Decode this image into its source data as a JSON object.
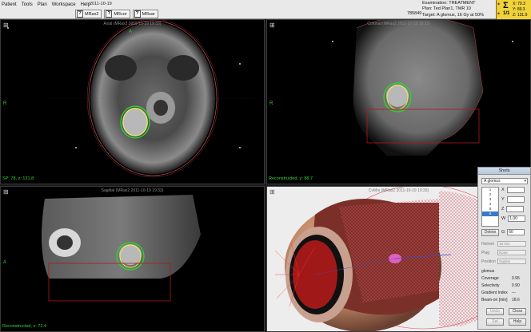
{
  "menu": [
    "Patient",
    "Tools",
    "Plan",
    "Workspace",
    "Help"
  ],
  "date": "2011-10-19",
  "tabs": [
    "MRax2",
    "MRcor",
    "MRsar"
  ],
  "code": "785849",
  "exam": {
    "examination": "Examination: TREATMENT",
    "plan": "Plan: Ted Plan1, TMR 10",
    "target": "Target: A glomus, 16 Gy at 50%"
  },
  "sigma": "Σ",
  "page_indicator": "1/1",
  "coords": {
    "x": "X: 70.3",
    "y": "Y: 89.3",
    "z": "Z: 131.9"
  },
  "viewports": {
    "axial": {
      "title": "Axial (MRax2 2011-10-19 19:33)",
      "corner": "⊞",
      "left": "R",
      "top": "A",
      "info": "SP: 78, z: 131.8"
    },
    "coronal": {
      "title": "Coronal (MRax2 2011-10-19 19:33)",
      "corner": "⊞",
      "left": "R",
      "info": "Reconstructed, y: 88.7"
    },
    "sagittal": {
      "title": "Sagittal (MRax2 2011-10-19 19:33)",
      "corner": "⊞",
      "left": "A",
      "info": "Reconstructed, x: 72.4"
    },
    "volume": {
      "title": "CvMrs (MRax2 2011-10-19 19:33)",
      "corner": "⊞"
    }
  },
  "shots": {
    "title": "Shots",
    "selected_target": "A glomus",
    "list": [
      "1",
      "2",
      "3",
      "4",
      "5",
      "6"
    ],
    "x_label": "X",
    "y_label": "Y",
    "z_label": "Z",
    "w_label": "W",
    "w_value": "1.00",
    "g_label": "G",
    "g_value": "60",
    "delete_label": "Delete",
    "helmet_label": "Helmet",
    "helmet_value": "18 mm",
    "plug_label": "Plug",
    "plug_value": "None",
    "position_label": "Position",
    "position_value": "Supine",
    "target_name": "glomus",
    "coverage_label": "Coverage",
    "coverage_value": "0.95",
    "selectivity_label": "Selectivity",
    "selectivity_value": "0.90",
    "gradient_label": "Gradient Index",
    "gradient_value": "---",
    "beamon_label": "Beam-on [min]",
    "beamon_value": "18.6",
    "undo_label": "Undo",
    "close_label": "Close",
    "set_label": "Set",
    "help_label": "Help"
  },
  "colors": {
    "contour_green": "#22e022",
    "contour_yellow": "#f0f040",
    "box_red": "#b01818",
    "accent_yellow": "#f0d23a"
  }
}
